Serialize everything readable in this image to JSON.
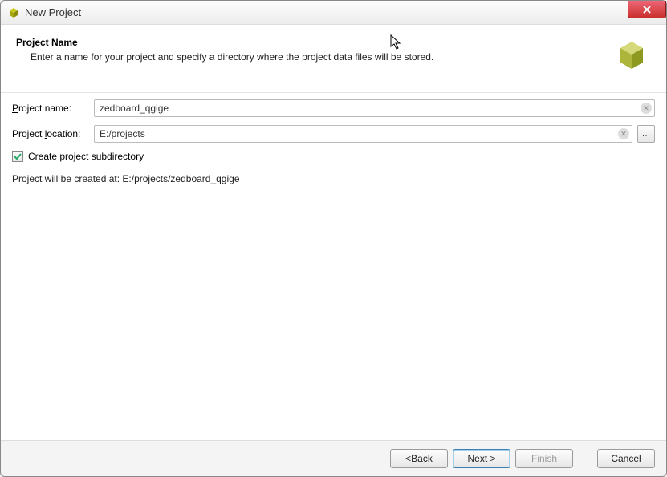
{
  "window": {
    "title": "New Project"
  },
  "header": {
    "title": "Project Name",
    "description": "Enter a name for your project and specify a directory where the project data files will be stored."
  },
  "form": {
    "name_label": "Project name:",
    "name_value": "zedboard_qgige",
    "location_label": "Project location:",
    "location_value": "E:/projects",
    "browse_label": "…",
    "subdir_checked": true,
    "subdir_label": "Create project subdirectory",
    "created_at_label": "Project will be created at: E:/projects/zedboard_qgige"
  },
  "buttons": {
    "back": "< Back",
    "next": "Next >",
    "finish": "Finish",
    "cancel": "Cancel"
  },
  "mnemonics": {
    "name": "P",
    "location": "l",
    "back": "B",
    "next": "N",
    "finish": "F"
  }
}
